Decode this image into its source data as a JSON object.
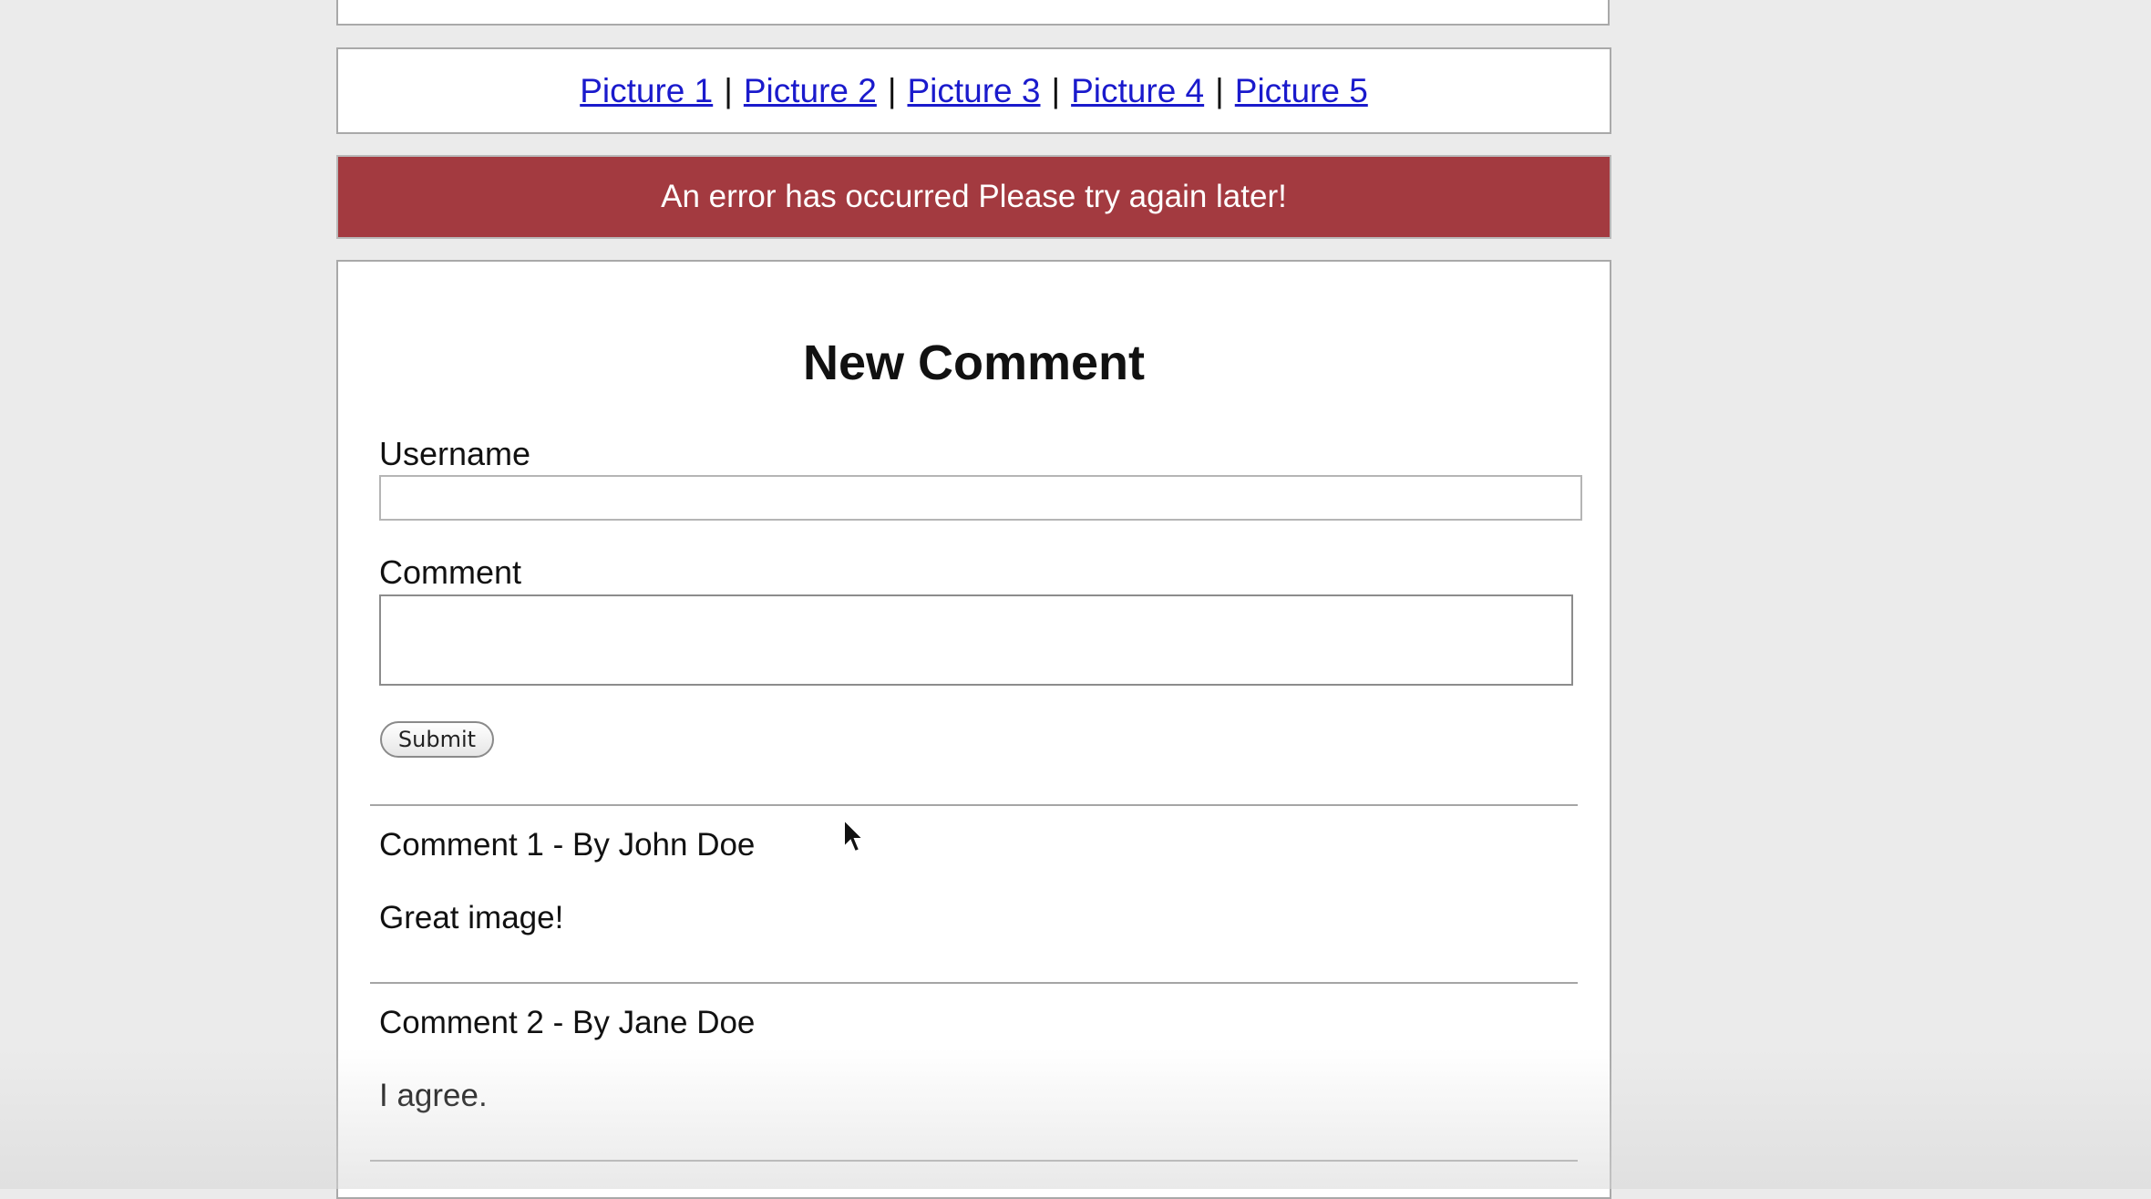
{
  "nav": {
    "links": [
      "Picture 1",
      "Picture 2",
      "Picture 3",
      "Picture 4",
      "Picture 5"
    ],
    "separator": "|"
  },
  "error": {
    "message": "An error has occurred Please try again later!",
    "color": "#a33a40"
  },
  "form": {
    "title": "New Comment",
    "username_label": "Username",
    "username_value": "",
    "comment_label": "Comment",
    "comment_value": "",
    "submit_label": "Submit"
  },
  "comments": [
    {
      "header": "Comment 1 - By John Doe",
      "body": "Great image!"
    },
    {
      "header": "Comment 2 - By Jane Doe",
      "body": "I agree."
    }
  ],
  "colors": {
    "link": "#1a1acc",
    "background": "#ebebeb",
    "panel": "#ffffff"
  }
}
